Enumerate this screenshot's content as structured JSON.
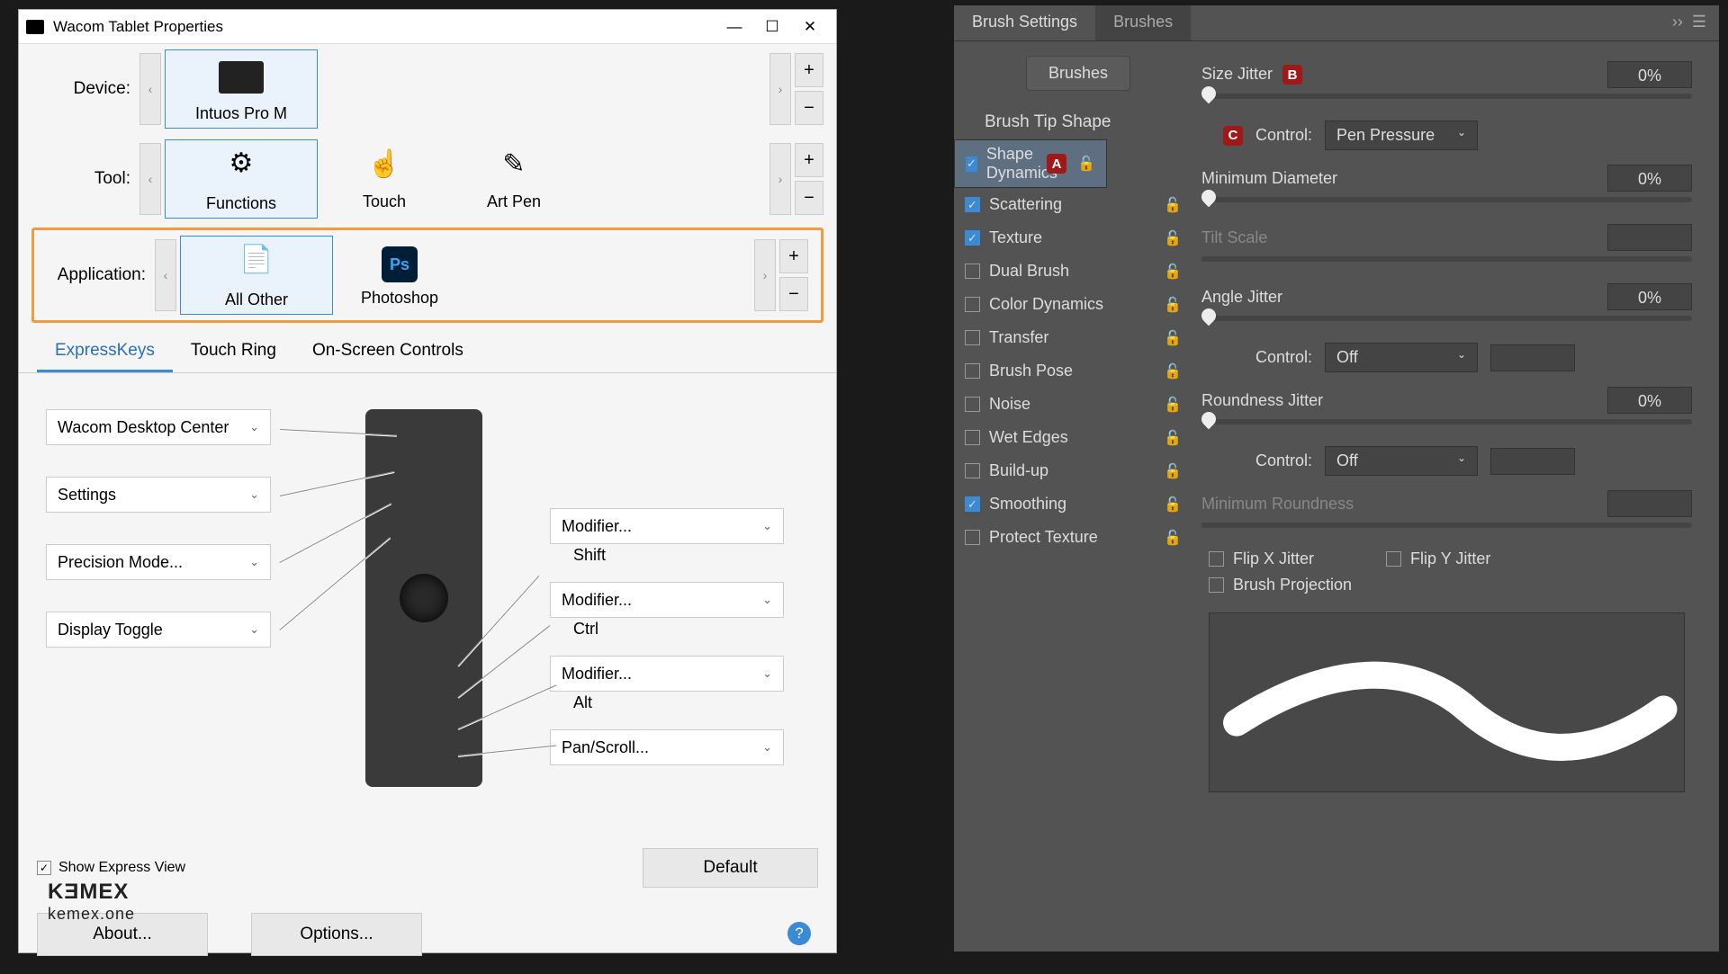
{
  "wacom": {
    "title": "Wacom Tablet Properties",
    "labels": {
      "device": "Device:",
      "tool": "Tool:",
      "application": "Application:"
    },
    "devices": [
      {
        "name": "Intuos Pro M"
      }
    ],
    "tools": [
      {
        "name": "Functions",
        "selected": true
      },
      {
        "name": "Touch"
      },
      {
        "name": "Art Pen"
      }
    ],
    "applications": [
      {
        "name": "All Other",
        "selected": true
      },
      {
        "name": "Photoshop"
      }
    ],
    "tabs": [
      "ExpressKeys",
      "Touch Ring",
      "On-Screen Controls"
    ],
    "left_keys": [
      "Wacom Desktop Center",
      "Settings",
      "Precision Mode...",
      "Display Toggle"
    ],
    "right_keys": [
      {
        "main": "Modifier...",
        "sub": "Shift"
      },
      {
        "main": "Modifier...",
        "sub": "Ctrl"
      },
      {
        "main": "Modifier...",
        "sub": "Alt"
      },
      {
        "main": "Pan/Scroll..."
      }
    ],
    "show_express": "Show Express View",
    "default_btn": "Default",
    "about_btn": "About...",
    "options_btn": "Options..."
  },
  "brush": {
    "tabs": [
      "Brush Settings",
      "Brushes"
    ],
    "brushes_btn": "Brushes",
    "tip_shape": "Brush Tip Shape",
    "options": [
      {
        "label": "Shape Dynamics",
        "checked": true,
        "selected": true,
        "badge": "A"
      },
      {
        "label": "Scattering",
        "checked": true
      },
      {
        "label": "Texture",
        "checked": true
      },
      {
        "label": "Dual Brush",
        "checked": false
      },
      {
        "label": "Color Dynamics",
        "checked": false
      },
      {
        "label": "Transfer",
        "checked": false
      },
      {
        "label": "Brush Pose",
        "checked": false
      },
      {
        "label": "Noise",
        "checked": false
      },
      {
        "label": "Wet Edges",
        "checked": false
      },
      {
        "label": "Build-up",
        "checked": false
      },
      {
        "label": "Smoothing",
        "checked": true
      },
      {
        "label": "Protect Texture",
        "checked": false
      }
    ],
    "size_jitter": {
      "label": "Size Jitter",
      "value": "0%",
      "badge": "B"
    },
    "control_label": "Control:",
    "control1": "Pen Pressure",
    "control1_badge": "C",
    "min_diameter": {
      "label": "Minimum Diameter",
      "value": "0%"
    },
    "tilt_scale": "Tilt Scale",
    "angle_jitter": {
      "label": "Angle Jitter",
      "value": "0%"
    },
    "control2": "Off",
    "round_jitter": {
      "label": "Roundness Jitter",
      "value": "0%"
    },
    "control3": "Off",
    "min_round": "Minimum Roundness",
    "flipx": "Flip X Jitter",
    "flipy": "Flip Y Jitter",
    "projection": "Brush Projection"
  },
  "watermark": {
    "brand": "KƎMEX",
    "url": "kemex.one"
  }
}
